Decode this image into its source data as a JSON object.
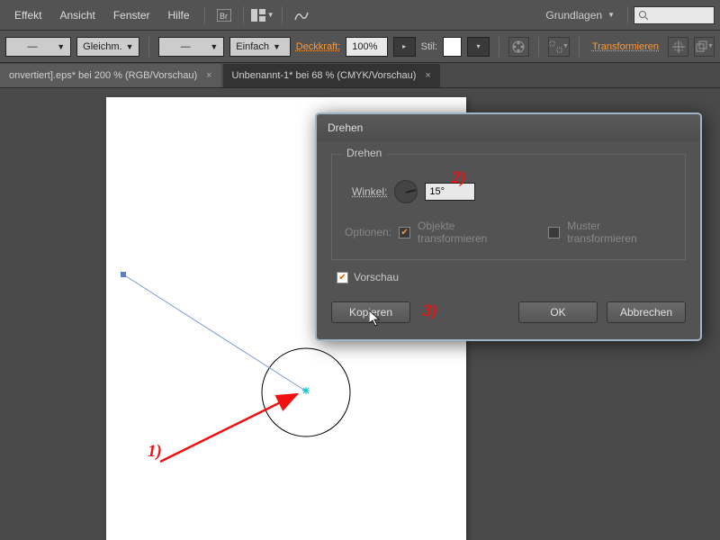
{
  "menu": {
    "items": [
      "Effekt",
      "Ansicht",
      "Fenster",
      "Hilfe"
    ],
    "workspace": "Grundlagen"
  },
  "options": {
    "profile": "Gleichm.",
    "brush": "Einfach",
    "opacity_label": "Deckkraft:",
    "opacity_val": "100%",
    "style_label": "Stil:",
    "transform": "Transformieren"
  },
  "tabs": [
    {
      "label": "onvertiert].eps* bei 200 % (RGB/Vorschau)"
    },
    {
      "label": "Unbenannt-1* bei 68 % (CMYK/Vorschau)"
    }
  ],
  "dialog": {
    "title": "Drehen",
    "group": "Drehen",
    "angle_label": "Winkel:",
    "angle_value": "15°",
    "options_label": "Optionen:",
    "opt1": "Objekte transformieren",
    "opt2": "Muster transformieren",
    "preview": "Vorschau",
    "copy": "Kopieren",
    "ok": "OK",
    "cancel": "Abbrechen"
  },
  "annotations": {
    "a1": "1)",
    "a2": "2)",
    "a3": "3)"
  }
}
